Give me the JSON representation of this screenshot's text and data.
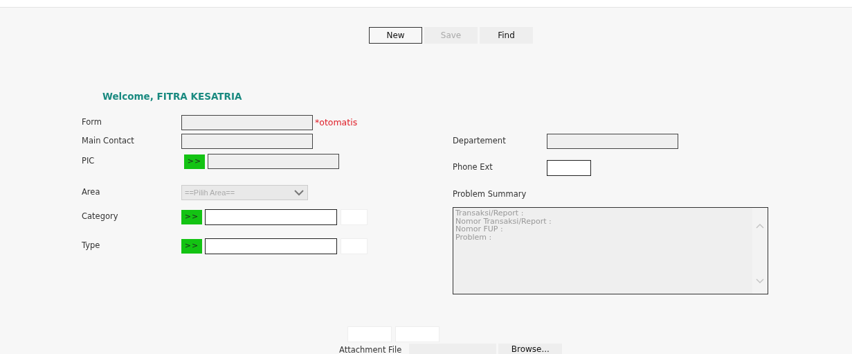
{
  "toolbar": [
    {
      "label": "New",
      "disabled": false,
      "focused": true
    },
    {
      "label": "Save",
      "disabled": true,
      "focused": false
    },
    {
      "label": "Find",
      "disabled": false,
      "focused": false
    }
  ],
  "greeting": "Welcome, FITRA KESATRIA",
  "left_fields": [
    {
      "label": "Form",
      "kind": "readonly",
      "note": "*otomatis"
    },
    {
      "label": "Main Contact",
      "kind": "readonly"
    },
    {
      "label": "PIC",
      "kind": "lookup_readonly",
      "button": ">>"
    },
    {
      "label": "Area",
      "kind": "select",
      "value": "==Pilih Area==",
      "disabled": true
    },
    {
      "label": "Category",
      "kind": "lookup",
      "button": ">>"
    },
    {
      "label": "Type",
      "kind": "lookup",
      "button": ">>"
    }
  ],
  "right_fields": [
    {
      "label": "Departement",
      "kind": "readonly"
    },
    {
      "label": "Phone Ext",
      "kind": "short"
    },
    {
      "label": "Problem Summary",
      "kind": "textarea",
      "placeholder": "Transaksi/Report :\nNomor Transaksi/Report :\nNomor FUP :\nProblem :"
    }
  ],
  "attachment": {
    "label": "Attachment File",
    "button": "Browse..."
  }
}
